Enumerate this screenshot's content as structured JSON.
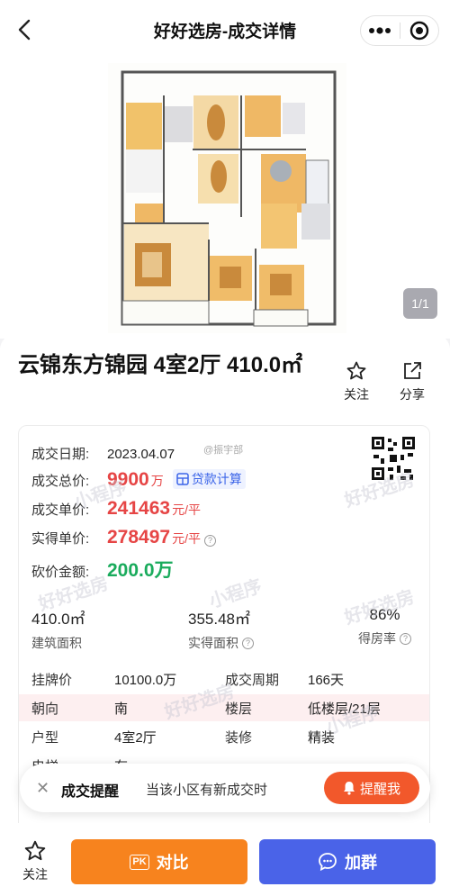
{
  "nav": {
    "title": "好好选房-成交详情",
    "img_counter": "1/1"
  },
  "house": {
    "title": "云锦东方锦园 4室2厅 410.0㎡",
    "follow_label": "关注",
    "share_label": "分享"
  },
  "deal": {
    "date_label": "成交日期:",
    "date": "2023.04.07",
    "total_label": "成交总价:",
    "total": "9900",
    "total_unit": "万",
    "loan_label": "贷款计算",
    "unit_label": "成交单价:",
    "unit_price": "241463",
    "unit_price_unit": "元/平",
    "actual_label": "实得单价:",
    "actual_price": "278497",
    "actual_price_unit": "元/平",
    "cut_label": "砍价金额:",
    "cut_amount": "200.0万",
    "weibo": "@振宇部"
  },
  "stats": [
    {
      "num": "410.0㎡",
      "label": "建筑面积"
    },
    {
      "num": "355.48㎡",
      "label": "实得面积"
    },
    {
      "num": "86%",
      "label": "得房率"
    }
  ],
  "details": [
    {
      "l1": "挂牌价",
      "v1": "10100.0万",
      "l2": "成交周期",
      "v2": "166天"
    },
    {
      "l1": "朝向",
      "v1": "南",
      "l2": "楼层",
      "v2": "低楼层/21层"
    },
    {
      "l1": "户型",
      "v1": "4室2厅",
      "l2": "装修",
      "v2": "精装"
    },
    {
      "l1": "电梯",
      "v1": "有",
      "l2": "",
      "v2": ""
    }
  ],
  "watermark": {
    "app": "好好选房",
    "sub": "小程序"
  },
  "toast": {
    "title": "成交提醒",
    "desc": "当该小区有新成交时",
    "button": "提醒我"
  },
  "bottom": {
    "follow": "关注",
    "compare": "对比",
    "compare_badge": "PK",
    "group": "加群"
  },
  "colors": {
    "red": "#e64545",
    "green": "#1aab5c",
    "orange": "#f7831e",
    "blue": "#4a63e8",
    "remind": "#f2582b"
  }
}
